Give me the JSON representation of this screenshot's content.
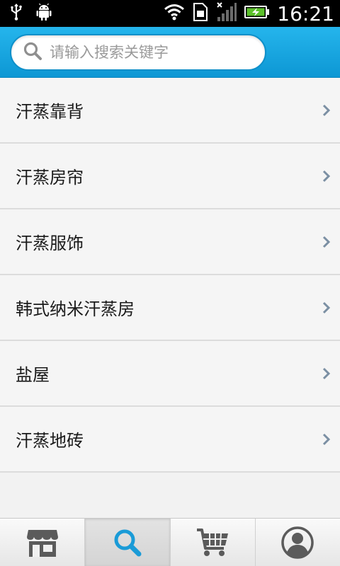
{
  "status_bar": {
    "time": "16:21"
  },
  "search": {
    "placeholder": "请输入搜索关键字",
    "value": ""
  },
  "list": {
    "items": [
      {
        "label": "汗蒸靠背"
      },
      {
        "label": "汗蒸房帘"
      },
      {
        "label": "汗蒸服饰"
      },
      {
        "label": "韩式纳米汗蒸房"
      },
      {
        "label": "盐屋"
      },
      {
        "label": "汗蒸地砖"
      }
    ]
  },
  "bottom_nav": {
    "tabs": [
      {
        "icon": "store-icon",
        "active": false
      },
      {
        "icon": "search-icon",
        "active": true
      },
      {
        "icon": "cart-icon",
        "active": false
      },
      {
        "icon": "user-icon",
        "active": false
      }
    ]
  },
  "colors": {
    "header": "#1aa6e1",
    "accent": "#1a9bd7",
    "icon_gray": "#5b5b5b"
  }
}
